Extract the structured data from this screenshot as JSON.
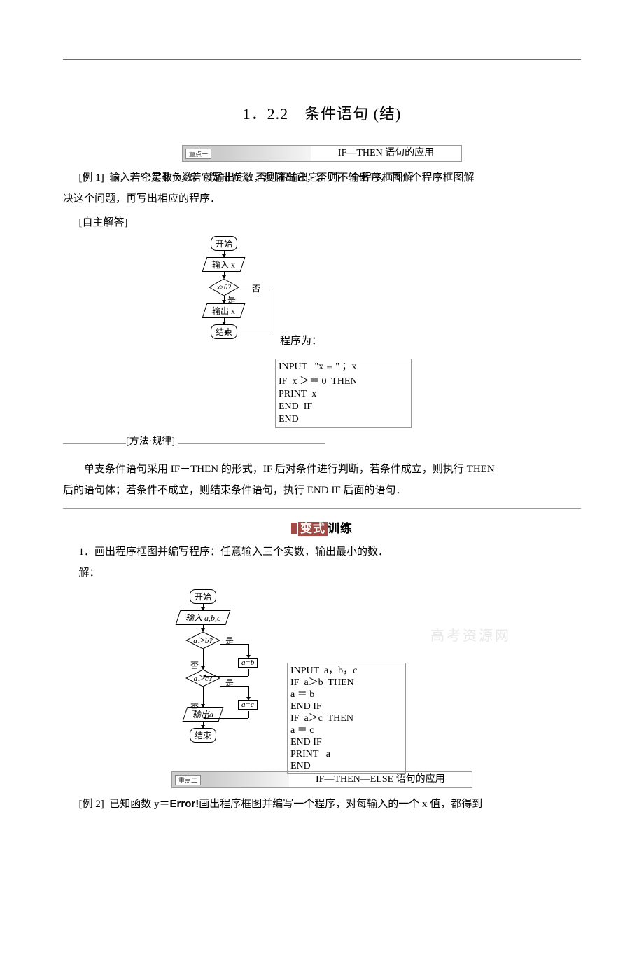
{
  "title": "1．2.2　条件语句  (结)",
  "banner1": {
    "tag": "重点一",
    "text": "IF—THEN 语句的应用"
  },
  "example1": {
    "prefix": "[例 1]",
    "body": "输入一个实数 x，若它是非负数，就输出它，否则不输出它，画一个程序框图解",
    "body2": "决这个问题，再写出相应的程序．",
    "answer_label": "[自主解答]"
  },
  "flow1": {
    "start": "开始",
    "input": "输入 x",
    "cond": "x≥0?",
    "no": "否",
    "yes": "是",
    "output": "输出 x",
    "end": "结束",
    "prog_label": "程序为："
  },
  "prog1": {
    "l1a": "INPUT   \"x ",
    "l1b": " \" ；x",
    "l2": "IF  x ＞＝ 0  THEN",
    "l3": "PRINT  x",
    "l4": "END  IF",
    "l5": "END"
  },
  "method_label": "[方法·规律]",
  "explain1": "单支条件语句采用 IF－THEN 的形式，IF 后对条件进行判断，若条件成立，则执行 THEN",
  "explain2": "后的语句体；若条件不成立，则结束条件语句，执行 END IF 后面的语句．",
  "sub_banner": {
    "red": "变式",
    "black": "训练"
  },
  "practice1": {
    "line": "1．画出程序框图并编写程序：任意输入三个实数，输出最小的数．",
    "answer": "解："
  },
  "flow2": {
    "start": "开始",
    "input": "输入 a,b,c",
    "cond1": "a＞b?",
    "cond2": "a＞c?",
    "assign1": "a=b",
    "assign2": "a=c",
    "yes": "是",
    "no": "否",
    "output": "输出a",
    "end": "结束"
  },
  "prog2": {
    "l1": "INPUT  a，b，c",
    "l2": "IF  a＞b  THEN",
    "l3": "a ＝ b",
    "l4": "END IF",
    "l5": "IF  a＞c  THEN",
    "l6": "a ＝ c",
    "l7": "END IF",
    "l8": "PRINT   a",
    "l9": "END"
  },
  "watermark": "高考资源网",
  "banner2": {
    "tag": "重点二",
    "text": "IF—THEN—ELSE 语句的应用"
  },
  "example2": {
    "prefix": "[例 2]",
    "body_a": "已知函数 y＝",
    "error": "Error!",
    "body_b": "画出程序框图并编写一个程序，对每输入的一个 x 值，都得到"
  }
}
